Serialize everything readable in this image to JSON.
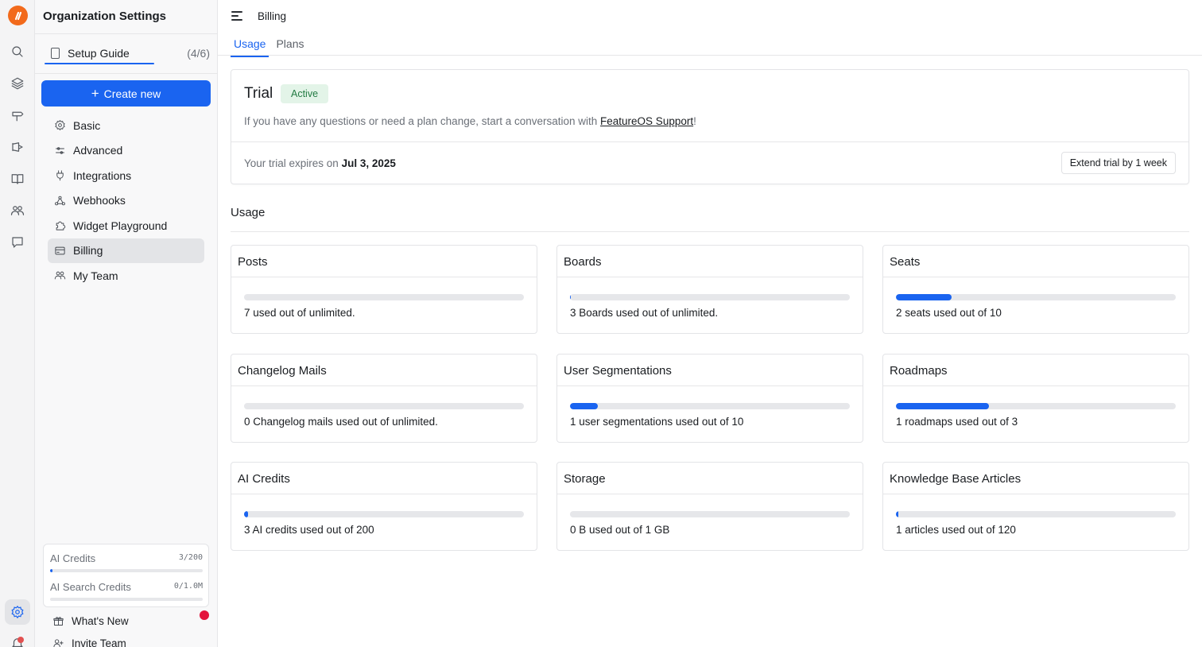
{
  "sidebar": {
    "title": "Organization Settings",
    "setup_guide": {
      "label": "Setup Guide",
      "count": "(4/6)"
    },
    "create_new": "Create new",
    "nav": [
      {
        "label": "Basic",
        "icon": "gear-icon"
      },
      {
        "label": "Advanced",
        "icon": "sliders-icon"
      },
      {
        "label": "Integrations",
        "icon": "plug-icon"
      },
      {
        "label": "Webhooks",
        "icon": "webhook-icon"
      },
      {
        "label": "Widget Playground",
        "icon": "puzzle-icon"
      },
      {
        "label": "Billing",
        "icon": "credit-card-icon",
        "active": true
      },
      {
        "label": "My Team",
        "icon": "team-icon"
      }
    ],
    "credits": [
      {
        "name": "AI Credits",
        "value": "3/200",
        "fraction": 0.015
      },
      {
        "name": "AI Search Credits",
        "value": "0/1.0M",
        "fraction": 0
      }
    ],
    "whats_new": "What's New",
    "invite_team": "Invite Team"
  },
  "header": {
    "title": "Billing",
    "tabs": [
      {
        "label": "Usage",
        "active": true
      },
      {
        "label": "Plans",
        "active": false
      }
    ]
  },
  "trial": {
    "title": "Trial",
    "status": "Active",
    "description_pre": "If you have any questions or need a plan change, start a conversation with ",
    "support_link": "FeatureOS Support",
    "description_post": "!",
    "expires_pre": "Your trial expires on ",
    "expires_date": "Jul 3, 2025",
    "extend_button": "Extend trial by 1 week"
  },
  "usage": {
    "heading": "Usage",
    "cards": [
      {
        "title": "Posts",
        "text": "7 used out of unlimited.",
        "fraction": 0
      },
      {
        "title": "Boards",
        "text": "3 Boards used out of unlimited.",
        "fraction": 0.003
      },
      {
        "title": "Seats",
        "text": "2 seats used out of 10",
        "fraction": 0.2
      },
      {
        "title": "Changelog Mails",
        "text": "0 Changelog mails used out of unlimited.",
        "fraction": 0
      },
      {
        "title": "User Segmentations",
        "text": "1 user segmentations used out of 10",
        "fraction": 0.1
      },
      {
        "title": "Roadmaps",
        "text": "1 roadmaps used out of 3",
        "fraction": 0.3333
      },
      {
        "title": "AI Credits",
        "text": "3 AI credits used out of 200",
        "fraction": 0.015
      },
      {
        "title": "Storage",
        "text": "0 B used out of 1 GB",
        "fraction": 0
      },
      {
        "title": "Knowledge Base Articles",
        "text": "1 articles used out of 120",
        "fraction": 0.0083
      }
    ]
  },
  "colors": {
    "accent": "#1a64f0",
    "brand": "#f26a1b",
    "active_badge_bg": "#e3f4e8",
    "active_badge_text": "#237b43",
    "notification": "#e3143c"
  }
}
